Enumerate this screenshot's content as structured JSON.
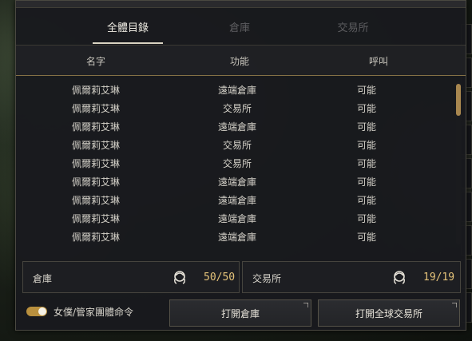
{
  "tabs": [
    {
      "label": "全體目錄",
      "active": true
    },
    {
      "label": "倉庫",
      "active": false
    },
    {
      "label": "交易所",
      "active": false
    }
  ],
  "columns": [
    "名字",
    "功能",
    "呼叫"
  ],
  "rows": [
    {
      "name": "佩爾莉艾琳",
      "function": "遠端倉庫",
      "call": "可能"
    },
    {
      "name": "佩爾莉艾琳",
      "function": "交易所",
      "call": "可能"
    },
    {
      "name": "佩爾莉艾琳",
      "function": "遠端倉庫",
      "call": "可能"
    },
    {
      "name": "佩爾莉艾琳",
      "function": "交易所",
      "call": "可能"
    },
    {
      "name": "佩爾莉艾琳",
      "function": "交易所",
      "call": "可能"
    },
    {
      "name": "佩爾莉艾琳",
      "function": "遠端倉庫",
      "call": "可能"
    },
    {
      "name": "佩爾莉艾琳",
      "function": "遠端倉庫",
      "call": "可能"
    },
    {
      "name": "佩爾莉艾琳",
      "function": "遠端倉庫",
      "call": "可能"
    },
    {
      "name": "佩爾莉艾琳",
      "function": "遠端倉庫",
      "call": "可能"
    }
  ],
  "warehouse": {
    "label": "倉庫",
    "value": "50/50",
    "icon": "maid-icon"
  },
  "market": {
    "label": "交易所",
    "value": "19/19",
    "icon": "maid-icon"
  },
  "toggle": {
    "label": "女僕/管家團體命令",
    "on": true
  },
  "buttons": {
    "open_warehouse": "打開倉庫",
    "open_market": "打開全球交易所"
  },
  "colors": {
    "accent": "#e6c47a",
    "toggle": "#b9903e",
    "scroll_thumb": "#a8874f"
  }
}
